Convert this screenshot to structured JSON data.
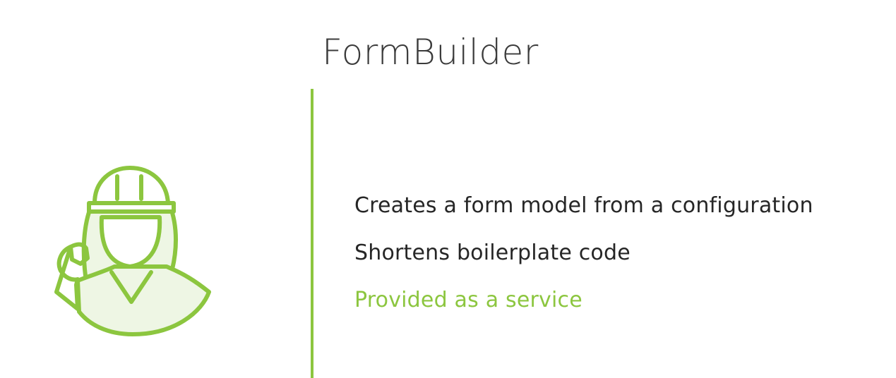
{
  "slide": {
    "title": "FormBuilder",
    "accent_color": "#8cc63f",
    "illustration_icon": "engineer-with-wrench-icon",
    "bullets": [
      {
        "text": "Creates a form model from a configuration",
        "highlighted": false
      },
      {
        "text": "Shortens boilerplate code",
        "highlighted": false
      },
      {
        "text": "Provided as a service",
        "highlighted": true
      }
    ]
  }
}
